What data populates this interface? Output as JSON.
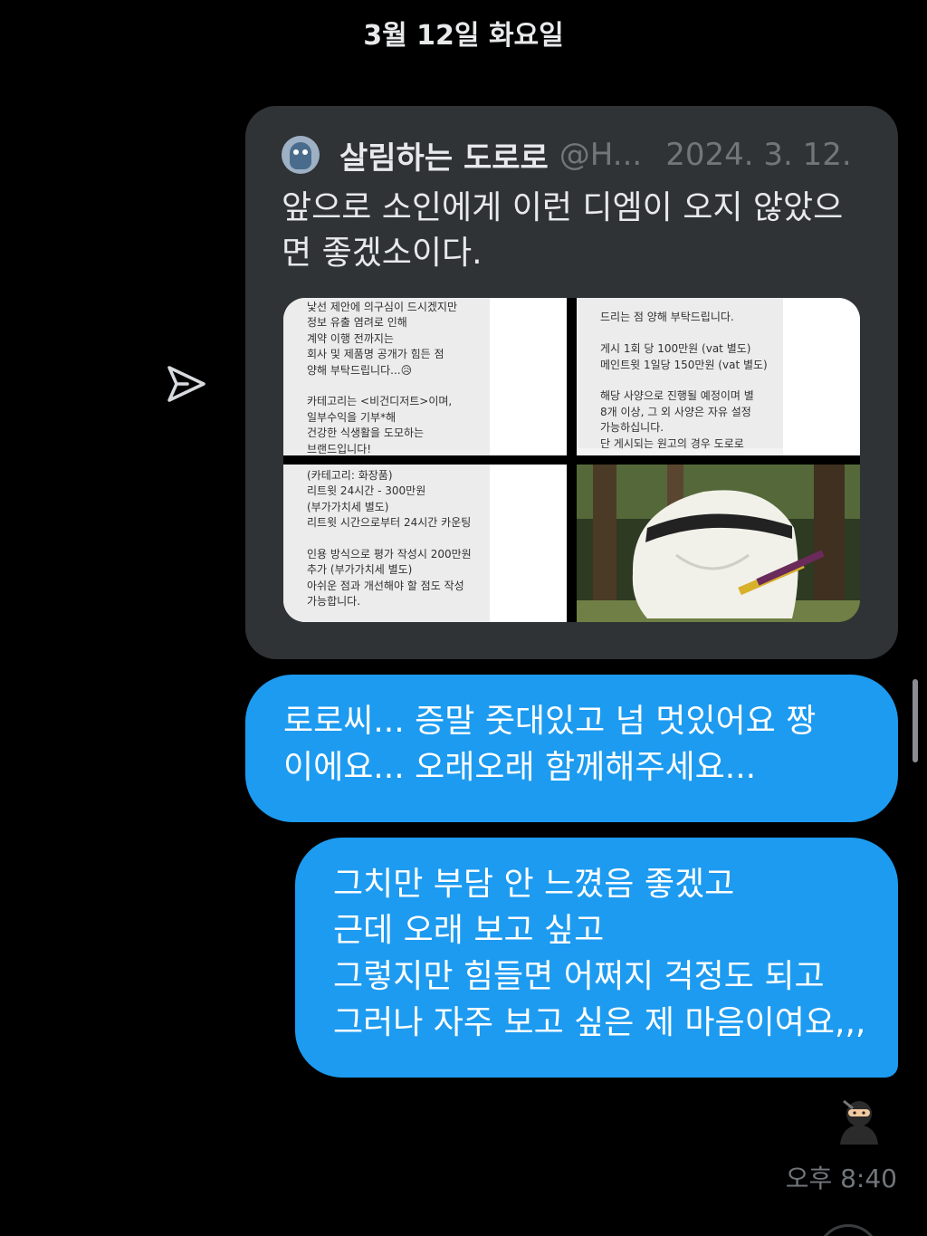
{
  "conversation": {
    "date_header": "3월 12일 화요일",
    "timestamp": "오후 8:40"
  },
  "quote": {
    "author": "살림하는 도로로",
    "handle": "@H...",
    "date": "2024. 3. 12.",
    "text_lines": [
      "앞으로 소인에게 이런 디엠이 오지 않았으",
      "면 좋겠소이다."
    ],
    "images": [
      {
        "lines": [
          "낯선 제안에 의구심이 드시겠지만",
          "정보 유출 염려로 인해",
          "계약 이행 전까지는",
          "회사 및 제품명 공개가 힘든 점",
          "양해 부탁드립니다...😥",
          "",
          "카테고리는 <비건디저트>이며,",
          "일부수익을 기부*해",
          "건강한 식생활을 도모하는",
          "브랜드입니다!"
        ]
      },
      {
        "lines": [
          "",
          "드리는 점 양해 부탁드립니다.",
          "",
          "게시 1회 당 100만원 (vat 별도)",
          "메인트윗 1일당 150만원 (vat 별도)",
          "",
          "해당 사양으로 진행될 예정이며 별",
          "8개 이상, 그 외 사양은 자유 설정",
          "가능하십니다.",
          "단 게시되는 원고의 경우 도로로"
        ]
      },
      {
        "lines": [
          "(카테고리: 화장품)",
          "리트윗 24시간 - 300만원",
          "(부가가치세 별도)",
          "리트윗 시간으로부터 24시간 카운팅",
          "",
          "인용 방식으로 평가 작성시 200만원",
          "추가 (부가가치세 별도)",
          "아쉬운 점과 개선해야 할 점도 작성",
          "가능합니다."
        ]
      },
      {
        "lines": []
      }
    ]
  },
  "messages": [
    {
      "lines": [
        "로로씨... 증말 줏대있고 넘 멋있어요 짱",
        "이에요... 오래오래 함께해주세요..."
      ]
    },
    {
      "lines": [
        "그치만 부담 안 느꼈음 좋겠고",
        "근데 오래 보고 싶고",
        "그렇지만 힘들면 어쩌지 걱정도 되고",
        "그러나 자주 보고 싶은 제 마음이여요,,,"
      ]
    }
  ],
  "icons": {
    "share": "share-send-icon",
    "reaction": "ninja-emoji-icon"
  },
  "colors": {
    "background": "#000000",
    "quote_card": "#2f3336",
    "bubble_blue": "#1d9bf0",
    "secondary_text": "#71767b"
  }
}
